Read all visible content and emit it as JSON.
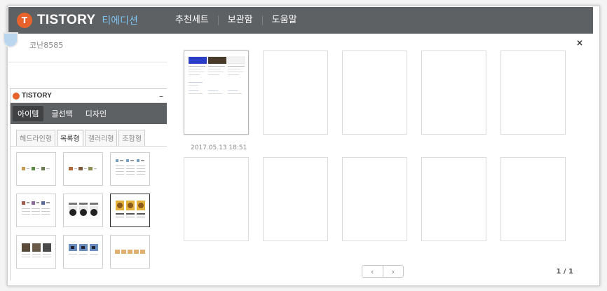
{
  "header": {
    "logo_glyph": "T",
    "brand": "TISTORY",
    "edition": "티에디션",
    "menu": [
      "추천세트",
      "보관함",
      "도움말"
    ]
  },
  "user": {
    "name": "코난8585"
  },
  "widget": {
    "brand": "TISTORY",
    "minimize": "–",
    "tabs": [
      "아이템",
      "글선택",
      "디자인"
    ],
    "active_tab": 0,
    "subtabs": [
      "헤드라인형",
      "목록형",
      "갤러리형",
      "조합형"
    ],
    "active_subtab": 1,
    "selected_thumbnail": 5
  },
  "preview": {
    "close": "×",
    "first_page_date": "2017.05.13 18:51",
    "pager_prev": "‹",
    "pager_next": "›",
    "page_count": "1 / 1"
  },
  "colors": {
    "toolbar": "#5e6164",
    "brand_orange": "#e8622b",
    "edition_blue": "#7fc4f0"
  }
}
